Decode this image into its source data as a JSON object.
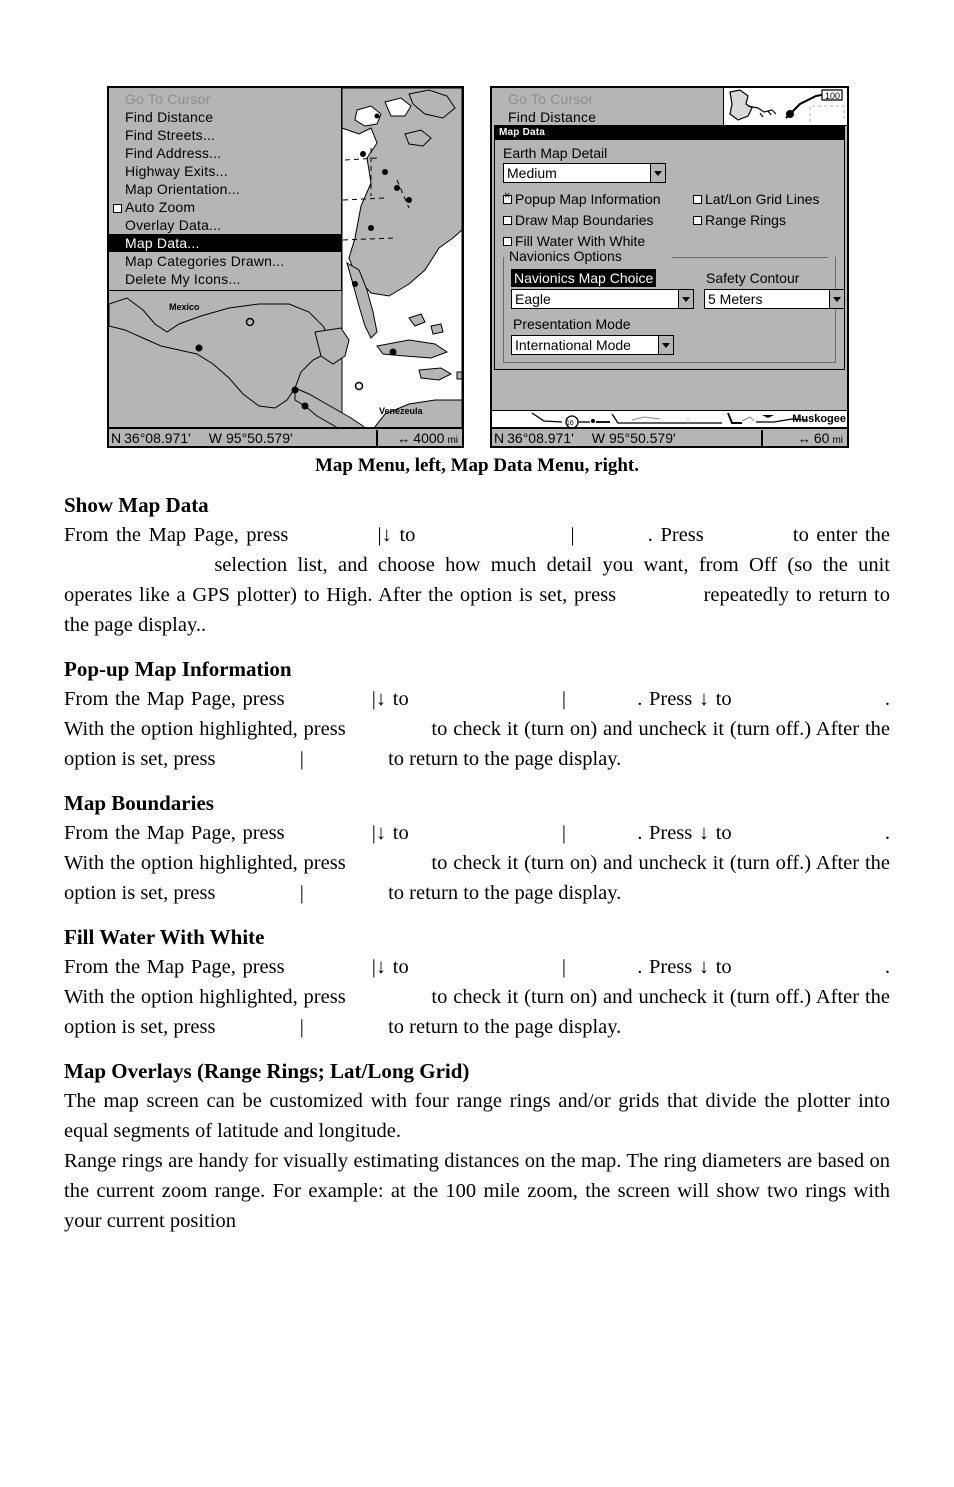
{
  "figure": {
    "left_device": {
      "menu_title": "Map Menu",
      "items": [
        {
          "label": "Go To Cursor",
          "state": "disabled",
          "checkbox": null
        },
        {
          "label": "Find Distance",
          "state": "normal",
          "checkbox": null
        },
        {
          "label": "Find Streets...",
          "state": "normal",
          "checkbox": null
        },
        {
          "label": "Find Address...",
          "state": "normal",
          "checkbox": null
        },
        {
          "label": "Highway Exits...",
          "state": "normal",
          "checkbox": null
        },
        {
          "label": "Map Orientation...",
          "state": "normal",
          "checkbox": null
        },
        {
          "label": "Auto Zoom",
          "state": "normal",
          "checkbox": "unchecked"
        },
        {
          "label": "Overlay Data...",
          "state": "normal",
          "checkbox": null
        },
        {
          "label": "Map Data...",
          "state": "selected",
          "checkbox": null
        },
        {
          "label": "Map Categories Drawn...",
          "state": "normal",
          "checkbox": null
        },
        {
          "label": "Delete My Icons...",
          "state": "normal",
          "checkbox": null
        }
      ],
      "map_labels": [
        "Mexico",
        "Venezeula"
      ],
      "status": {
        "lat_hemisphere": "N",
        "latitude": "36°08.971'",
        "lon_hemisphere": "W",
        "longitude": "95°50.579'",
        "zoom_value": "4000",
        "zoom_unit": "mi",
        "zoom_icon": "horizontal-double-arrow"
      }
    },
    "right_device": {
      "ghost_items": [
        {
          "label": "Go To Cursor",
          "state": "disabled"
        },
        {
          "label": "Find Distance",
          "state": "normal"
        }
      ],
      "dialog": {
        "title": "Map Data",
        "earth_map_detail_label": "Earth Map Detail",
        "earth_map_detail_value": "Medium",
        "checkboxes": [
          {
            "label": "Popup Map Information",
            "checked": true
          },
          {
            "label": "Lat/Lon Grid Lines",
            "checked": false
          },
          {
            "label": "Draw Map Boundaries",
            "checked": false
          },
          {
            "label": "Range Rings",
            "checked": false
          },
          {
            "label": "Fill Water With White",
            "checked": false
          }
        ],
        "group_legend": "Navionics Options",
        "navionics_map_choice_label": "Navionics Map Choice",
        "navionics_map_choice_value": "Eagle",
        "safety_contour_label": "Safety Contour",
        "safety_contour_value": "5 Meters",
        "presentation_mode_label": "Presentation Mode",
        "presentation_mode_value": "International Mode"
      },
      "scale_city": "Muskogee",
      "status": {
        "lat_hemisphere": "N",
        "latitude": "36°08.971'",
        "lon_hemisphere": "W",
        "longitude": "95°50.579'",
        "zoom_value": "60",
        "zoom_unit": "mi",
        "zoom_icon": "horizontal-double-arrow"
      }
    },
    "caption": "Map Menu, left, Map Data Menu, right."
  },
  "content": {
    "sections": [
      {
        "heading": "Show Map Data",
        "paragraphs": [
          {
            "id": "show-map-data-p1",
            "runs": [
              {
                "t": "text",
                "v": "From the Map Page, press"
              },
              {
                "t": "gap",
                "w": "md"
              },
              {
                "t": "text",
                "v": "|↓ to"
              },
              {
                "t": "gap",
                "w": "xl"
              },
              {
                "t": "text",
                "v": "|"
              },
              {
                "t": "gap",
                "w": "sm"
              },
              {
                "t": "text",
                "v": ". Press"
              },
              {
                "t": "gap",
                "w": "md"
              },
              {
                "t": "text",
                "v": "to enter the"
              },
              {
                "t": "gap",
                "w": "xl"
              },
              {
                "t": "text",
                "v": "selection list, and choose how much detail you want, from Off (so the unit operates like a GPS plotter) to High. After the option is set, press"
              },
              {
                "t": "gap",
                "w": "md"
              },
              {
                "t": "text",
                "v": "repeatedly to return to the page display.."
              }
            ]
          }
        ]
      },
      {
        "heading": "Pop-up Map Information",
        "paragraphs": [
          {
            "id": "popup-map-information-p1",
            "runs": [
              {
                "t": "text",
                "v": "From the Map Page, press"
              },
              {
                "t": "gap",
                "w": "md"
              },
              {
                "t": "text",
                "v": "|↓ to"
              },
              {
                "t": "gap",
                "w": "xl"
              },
              {
                "t": "text",
                "v": "|"
              },
              {
                "t": "gap",
                "w": "sm"
              },
              {
                "t": "text",
                "v": ". Press ↓ to"
              },
              {
                "t": "gap",
                "w": "xl"
              },
              {
                "t": "text",
                "v": ". With the option highlighted, press"
              },
              {
                "t": "gap",
                "w": "md"
              },
              {
                "t": "text",
                "v": "to check it (turn on) and uncheck it (turn off.) After the option is set, press"
              },
              {
                "t": "gap",
                "w": "md"
              },
              {
                "t": "text",
                "v": "|"
              },
              {
                "t": "gap",
                "w": "md"
              },
              {
                "t": "text",
                "v": "to return to the page display."
              }
            ]
          }
        ]
      },
      {
        "heading": "Map Boundaries",
        "paragraphs": [
          {
            "id": "map-boundaries-p1",
            "runs": [
              {
                "t": "text",
                "v": "From the Map Page, press"
              },
              {
                "t": "gap",
                "w": "md"
              },
              {
                "t": "text",
                "v": "|↓ to"
              },
              {
                "t": "gap",
                "w": "xl"
              },
              {
                "t": "text",
                "v": "|"
              },
              {
                "t": "gap",
                "w": "sm"
              },
              {
                "t": "text",
                "v": ". Press ↓ to"
              },
              {
                "t": "gap",
                "w": "xl"
              },
              {
                "t": "text",
                "v": ". With the option highlighted, press"
              },
              {
                "t": "gap",
                "w": "md"
              },
              {
                "t": "text",
                "v": "to check it (turn on) and uncheck it (turn off.) After the option is set, press"
              },
              {
                "t": "gap",
                "w": "md"
              },
              {
                "t": "text",
                "v": "|"
              },
              {
                "t": "gap",
                "w": "md"
              },
              {
                "t": "text",
                "v": "to return to the page display."
              }
            ]
          }
        ]
      },
      {
        "heading": "Fill Water With White",
        "paragraphs": [
          {
            "id": "fill-water-with-white-p1",
            "runs": [
              {
                "t": "text",
                "v": "From the Map Page, press"
              },
              {
                "t": "gap",
                "w": "md"
              },
              {
                "t": "text",
                "v": "|↓ to"
              },
              {
                "t": "gap",
                "w": "xl"
              },
              {
                "t": "text",
                "v": "|"
              },
              {
                "t": "gap",
                "w": "sm"
              },
              {
                "t": "text",
                "v": ". Press ↓ to"
              },
              {
                "t": "gap",
                "w": "xl"
              },
              {
                "t": "text",
                "v": ". With the option highlighted, press"
              },
              {
                "t": "gap",
                "w": "md"
              },
              {
                "t": "text",
                "v": "to check it (turn on) and uncheck it (turn off.) After the option is set, press"
              },
              {
                "t": "gap",
                "w": "md"
              },
              {
                "t": "text",
                "v": "|"
              },
              {
                "t": "gap",
                "w": "md"
              },
              {
                "t": "text",
                "v": "to return to the page display."
              }
            ]
          }
        ]
      },
      {
        "heading": "Map Overlays (Range Rings; Lat/Long Grid)",
        "paragraphs": [
          {
            "id": "map-overlays-p1",
            "runs": [
              {
                "t": "text",
                "v": "The map screen can be customized with four range rings and/or grids that divide the plotter into equal segments of latitude and longitude."
              }
            ]
          },
          {
            "id": "map-overlays-p2",
            "runs": [
              {
                "t": "text",
                "v": "Range rings are handy for visually estimating distances on the map. The ring diameters are based on the current zoom range. For example: at the 100 mile zoom, the screen will show two rings with your current position"
              }
            ]
          }
        ]
      }
    ]
  }
}
